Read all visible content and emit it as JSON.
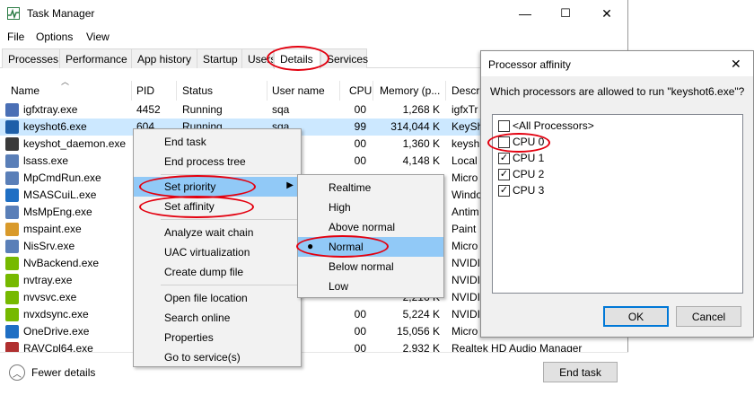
{
  "window": {
    "title": "Task Manager",
    "min": "—",
    "max": "☐",
    "close": "✕"
  },
  "menu": [
    "File",
    "Options",
    "View"
  ],
  "tabs": [
    "Processes",
    "Performance",
    "App history",
    "Startup",
    "Users",
    "Details",
    "Services"
  ],
  "columns": {
    "name": "Name",
    "pid": "PID",
    "status": "Status",
    "user": "User name",
    "cpu": "CPU",
    "memory": "Memory (p...",
    "desc": "Descri"
  },
  "rows": [
    {
      "name": "igfxtray.exe",
      "pid": "4452",
      "status": "Running",
      "user": "sqa",
      "cpu": "00",
      "mem": "1,268 K",
      "desc": "igfxTr",
      "color": "#4a6fb5"
    },
    {
      "name": "keyshot6.exe",
      "pid": "604",
      "status": "Running",
      "user": "sqa",
      "cpu": "99",
      "mem": "314,044 K",
      "desc": "KeySh",
      "color": "#1e5fa8"
    },
    {
      "name": "keyshot_daemon.exe",
      "pid": "",
      "status": "",
      "user": "",
      "cpu": "00",
      "mem": "1,360 K",
      "desc": "keysh",
      "color": "#3a3a3a"
    },
    {
      "name": "lsass.exe",
      "pid": "",
      "status": "",
      "user": "M",
      "cpu": "00",
      "mem": "4,148 K",
      "desc": "Local",
      "color": "#5a7fb8"
    },
    {
      "name": "MpCmdRun.exe",
      "pid": "",
      "status": "",
      "user": "",
      "cpu": "",
      "mem": "",
      "desc": "Micro",
      "color": "#5a7fb8"
    },
    {
      "name": "MSASCuiL.exe",
      "pid": "",
      "status": "",
      "user": "",
      "cpu": "",
      "mem": "",
      "desc": "Windo",
      "color": "#1f6fc4"
    },
    {
      "name": "MsMpEng.exe",
      "pid": "",
      "status": "",
      "user": "",
      "cpu": "",
      "mem": "",
      "desc": "Antim",
      "color": "#5a7fb8"
    },
    {
      "name": "mspaint.exe",
      "pid": "",
      "status": "",
      "user": "",
      "cpu": "",
      "mem": "",
      "desc": "Paint",
      "color": "#d99a2b"
    },
    {
      "name": "NisSrv.exe",
      "pid": "",
      "status": "",
      "user": "",
      "cpu": "",
      "mem": "",
      "desc": "Micro",
      "color": "#5a7fb8"
    },
    {
      "name": "NvBackend.exe",
      "pid": "",
      "status": "",
      "user": "",
      "cpu": "",
      "mem": "",
      "desc": "NVIDIA",
      "color": "#76b900"
    },
    {
      "name": "nvtray.exe",
      "pid": "",
      "status": "",
      "user": "",
      "cpu": "",
      "mem": "",
      "desc": "NVIDIA",
      "color": "#76b900"
    },
    {
      "name": "nvvsvc.exe",
      "pid": "",
      "status": "",
      "user": "",
      "cpu": "",
      "mem": "2,216 K",
      "desc": "NVIDIA",
      "color": "#76b900"
    },
    {
      "name": "nvxdsync.exe",
      "pid": "",
      "status": "",
      "user": "M",
      "cpu": "00",
      "mem": "5,224 K",
      "desc": "NVIDIA",
      "color": "#76b900"
    },
    {
      "name": "OneDrive.exe",
      "pid": "",
      "status": "",
      "user": "",
      "cpu": "00",
      "mem": "15,056 K",
      "desc": "Micro",
      "color": "#1f6fc4"
    },
    {
      "name": "RAVCpl64.exe",
      "pid": "",
      "status": "",
      "user": "",
      "cpu": "00",
      "mem": "2,932 K",
      "desc": "Realtek HD Audio Manager",
      "color": "#b03030"
    }
  ],
  "footer": {
    "fewer": "Fewer details",
    "end_task": "End task"
  },
  "context_menu": [
    "End task",
    "End process tree",
    "Set priority",
    "Set affinity",
    "Analyze wait chain",
    "UAC virtualization",
    "Create dump file",
    "Open file location",
    "Search online",
    "Properties",
    "Go to service(s)"
  ],
  "priority_menu": [
    "Realtime",
    "High",
    "Above normal",
    "Normal",
    "Below normal",
    "Low"
  ],
  "dialog": {
    "title": "Processor affinity",
    "question": "Which processors are allowed to run \"keyshot6.exe\"?",
    "items": [
      {
        "label": "<All Processors>",
        "checked": false
      },
      {
        "label": "CPU 0",
        "checked": false
      },
      {
        "label": "CPU 1",
        "checked": true
      },
      {
        "label": "CPU 2",
        "checked": true
      },
      {
        "label": "CPU 3",
        "checked": true
      }
    ],
    "ok": "OK",
    "cancel": "Cancel",
    "close": "✕"
  },
  "colors": {
    "selection": "#cce8ff",
    "menu_highlight": "#91c9f7",
    "annotation": "#e3000f"
  }
}
